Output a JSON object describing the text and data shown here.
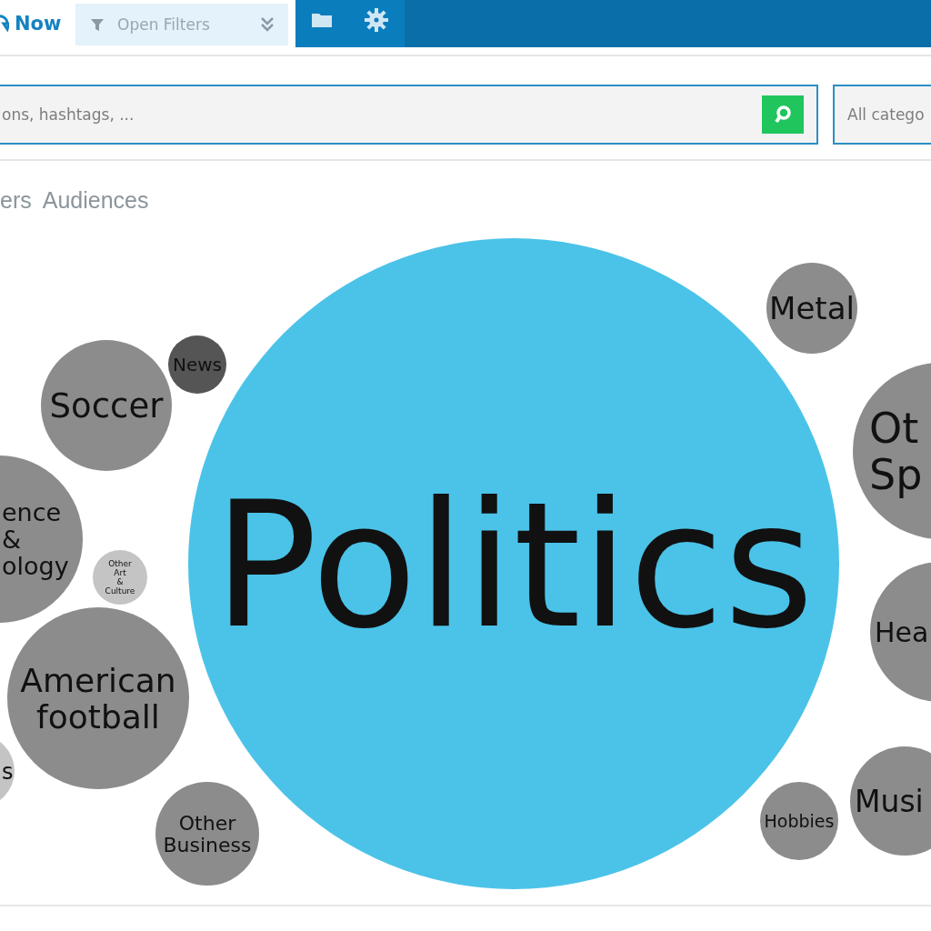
{
  "header": {
    "now_label": "Now",
    "filter_button": {
      "label": "Open Filters"
    }
  },
  "search": {
    "placeholder": "ons, hashtags, ...",
    "category_placeholder": "All catego"
  },
  "tabs": [
    {
      "label": "ers"
    },
    {
      "label": "Audiences"
    }
  ],
  "bubbles": [
    {
      "label": "Politics",
      "color": "#4bc3e8"
    },
    {
      "label": "Metal",
      "color": "#8c8c8c"
    },
    {
      "label": "Ot Sp",
      "color": "#8c8c8c"
    },
    {
      "label": "Hea",
      "color": "#8c8c8c"
    },
    {
      "label": "Musi",
      "color": "#8c8c8c"
    },
    {
      "label": "Hobbies",
      "color": "#8c8c8c"
    },
    {
      "label": "News",
      "color": "#555555"
    },
    {
      "label": "Soccer",
      "color": "#8c8c8c"
    },
    {
      "label": "ence & ology",
      "color": "#8c8c8c"
    },
    {
      "label": "Other Art & Culture",
      "color": "#c4c4c4"
    },
    {
      "label": "American football",
      "color": "#8c8c8c"
    },
    {
      "label": "s",
      "color": "#c4c4c4"
    },
    {
      "label": "Other Business",
      "color": "#8c8c8c"
    }
  ]
}
